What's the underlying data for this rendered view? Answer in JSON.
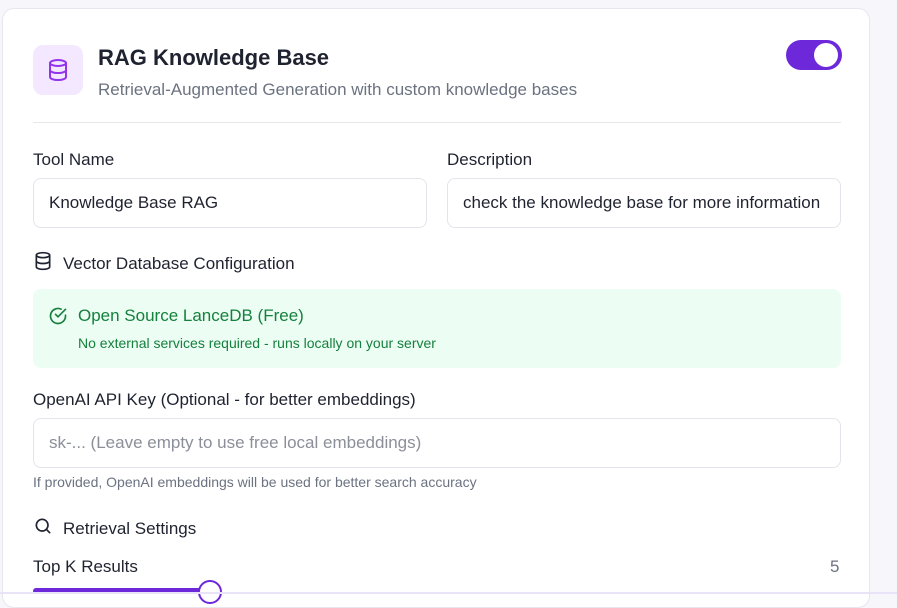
{
  "header": {
    "title": "RAG Knowledge Base",
    "subtitle": "Retrieval-Augmented Generation with custom knowledge bases",
    "icon": "database-icon",
    "enabled": true
  },
  "form": {
    "tool_name_label": "Tool Name",
    "tool_name_value": "Knowledge Base RAG",
    "description_label": "Description",
    "description_value": "check the knowledge base for more information"
  },
  "vector_db": {
    "section_title": "Vector Database Configuration",
    "icon": "database-icon",
    "option_title": "Open Source LanceDB (Free)",
    "option_desc": "No external services required - runs locally on your server",
    "option_icon": "check-circle-icon"
  },
  "openai": {
    "label": "OpenAI API Key (Optional - for better embeddings)",
    "placeholder": "sk-... (Leave empty to use free local embeddings)",
    "value": "",
    "hint": "If provided, OpenAI embeddings will be used for better search accuracy"
  },
  "retrieval": {
    "section_title": "Retrieval Settings",
    "icon": "search-icon",
    "top_k_label": "Top K Results",
    "top_k_value": "5"
  },
  "colors": {
    "accent": "#6d28d9",
    "success_bg": "#ecfdf3",
    "success_text": "#15803d"
  }
}
